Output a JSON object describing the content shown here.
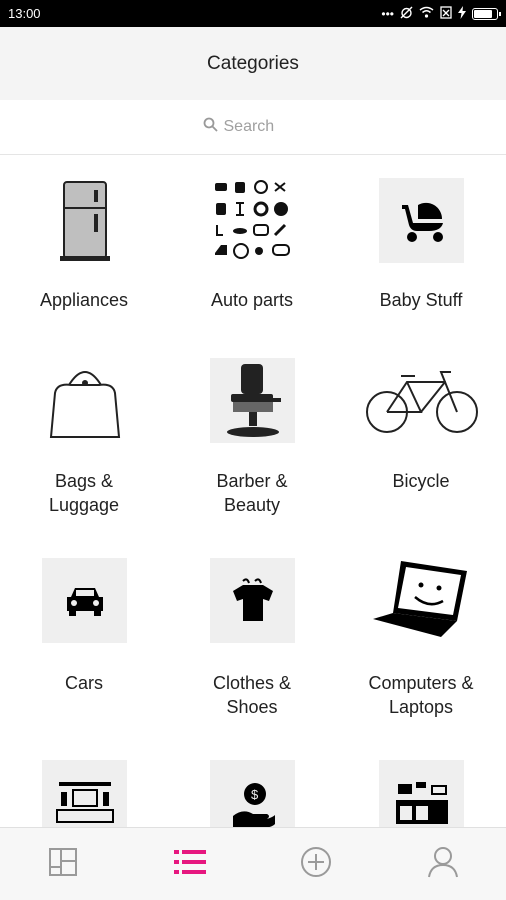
{
  "status": {
    "time": "13:00",
    "dots": "•••"
  },
  "header": {
    "title": "Categories"
  },
  "search": {
    "placeholder": "Search"
  },
  "categories": [
    {
      "label": "Appliances",
      "icon": "refrigerator-icon"
    },
    {
      "label": "Auto parts",
      "icon": "auto-parts-icon"
    },
    {
      "label": "Baby Stuff",
      "icon": "stroller-icon"
    },
    {
      "label": "Bags &\nLuggage",
      "icon": "handbag-icon"
    },
    {
      "label": "Barber &\nBeauty",
      "icon": "barber-chair-icon"
    },
    {
      "label": "Bicycle",
      "icon": "bicycle-icon"
    },
    {
      "label": "Cars",
      "icon": "car-icon"
    },
    {
      "label": "Clothes &\nShoes",
      "icon": "clothes-icon"
    },
    {
      "label": "Computers &\nLaptops",
      "icon": "laptop-icon"
    },
    {
      "label": "",
      "icon": "tv-stand-icon"
    },
    {
      "label": "",
      "icon": "money-hand-icon"
    },
    {
      "label": "",
      "icon": "kitchen-icon"
    }
  ],
  "tabs": [
    {
      "name": "dashboard",
      "icon": "dashboard-icon",
      "active": false
    },
    {
      "name": "categories",
      "icon": "list-icon",
      "active": true
    },
    {
      "name": "add",
      "icon": "plus-circle-icon",
      "active": false
    },
    {
      "name": "profile",
      "icon": "user-icon",
      "active": false
    }
  ],
  "colors": {
    "accent": "#e6177f",
    "inactive": "#9a9a9a"
  }
}
